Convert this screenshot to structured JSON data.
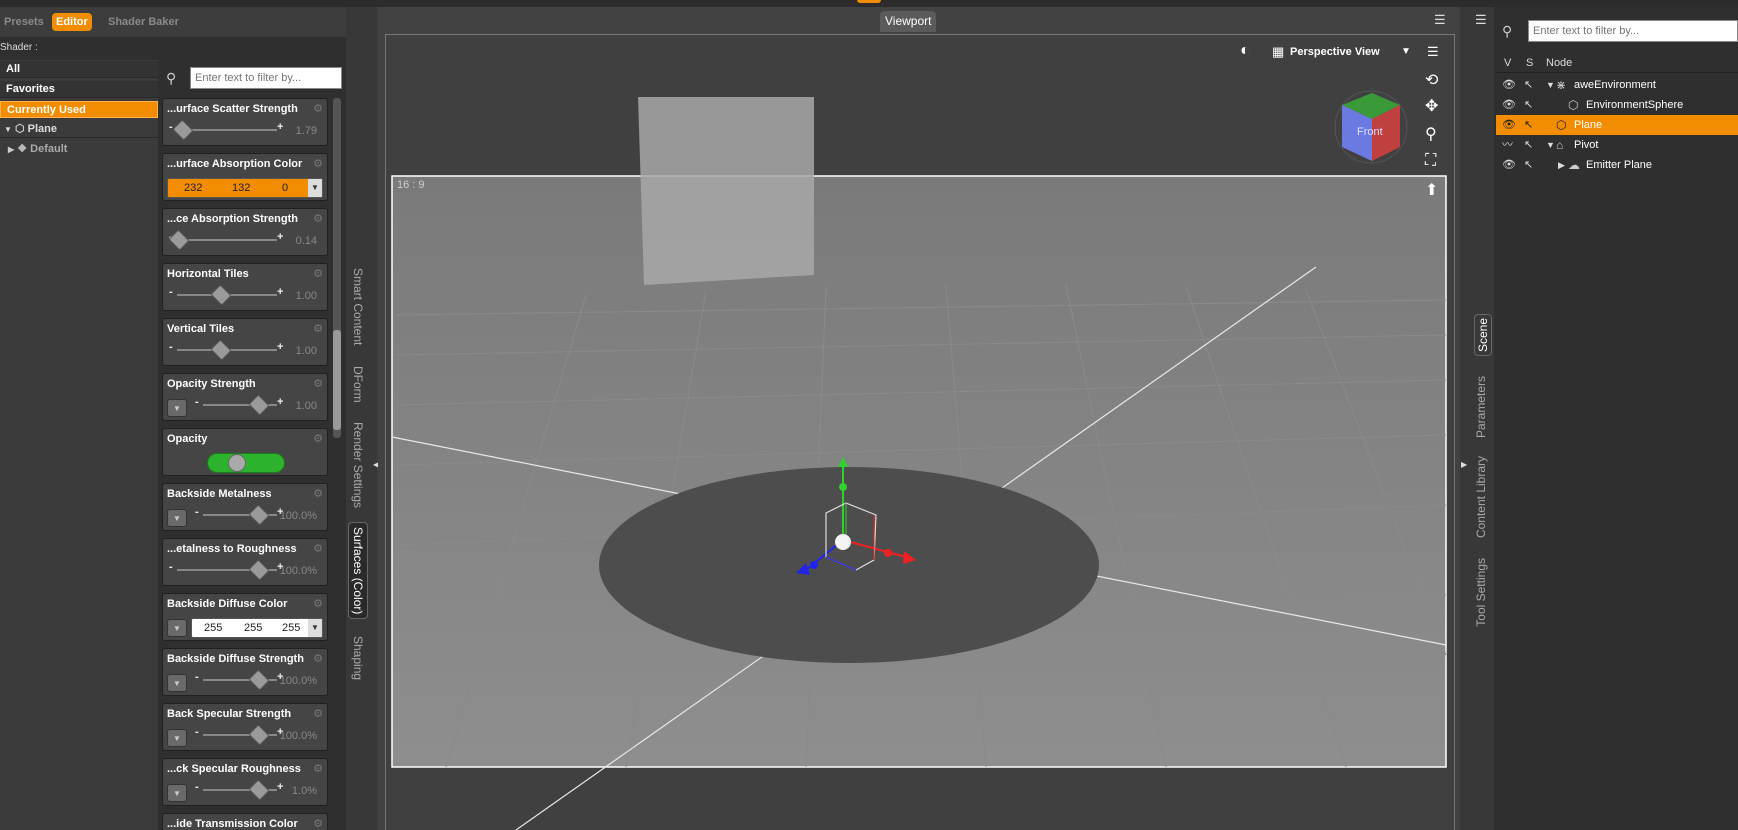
{
  "left": {
    "tabs": [
      "Presets",
      "Editor",
      "Shader Baker"
    ],
    "shader_label": "Shader :",
    "filter_placeholder": "Enter text to filter by...",
    "tree": {
      "all": "All",
      "favorites": "Favorites",
      "currently_used": "Currently Used",
      "plane": "Plane",
      "default": "Default"
    },
    "props": [
      {
        "title": "...urface Scatter Strength",
        "value": "1.79",
        "kind": "slider"
      },
      {
        "title": "...urface Absorption Color",
        "kind": "color",
        "r": "232",
        "g": "132",
        "b": "0",
        "bg": "#f28c00"
      },
      {
        "title": "...ce Absorption Strength",
        "value": "0.14",
        "kind": "slider"
      },
      {
        "title": "Horizontal Tiles",
        "value": "1.00",
        "kind": "slider"
      },
      {
        "title": "Vertical Tiles",
        "value": "1.00",
        "kind": "slider"
      },
      {
        "title": "Opacity Strength",
        "value": "1.00",
        "kind": "slider-drop"
      },
      {
        "title": "Opacity",
        "kind": "toggle",
        "toggle_label": "On"
      },
      {
        "title": "Backside Metalness",
        "value": "100.0%",
        "kind": "slider-drop"
      },
      {
        "title": "...etalness to Roughness",
        "value": "100.0%",
        "kind": "slider"
      },
      {
        "title": "Backside Diffuse Color",
        "kind": "color",
        "r": "255",
        "g": "255",
        "b": "255",
        "bg": "#ffffff"
      },
      {
        "title": "Backside Diffuse Strength",
        "value": "100.0%",
        "kind": "slider-drop"
      },
      {
        "title": "Back Specular Strength",
        "value": "100.0%",
        "kind": "slider-drop"
      },
      {
        "title": "...ck Specular Roughness",
        "value": "1.0%",
        "kind": "slider-drop"
      },
      {
        "title": "...ide Transmission Color",
        "kind": "title-only"
      }
    ],
    "vertical_tabs": [
      "Smart Content",
      "DForm",
      "Render Settings",
      "Surfaces (Color)",
      "Shaping"
    ]
  },
  "viewport": {
    "tab": "Viewport",
    "view_label": "Perspective View",
    "aspect": "16 : 9",
    "cube_label": "Front"
  },
  "right": {
    "vertical_tabs": [
      "Scene",
      "Parameters",
      "Content Library",
      "Tool Settings"
    ],
    "filter_placeholder": "Enter text to filter by...",
    "headers": [
      "V",
      "S",
      "Node"
    ],
    "nodes": [
      {
        "label": "aweEnvironment"
      },
      {
        "label": "EnvironmentSphere"
      },
      {
        "label": "Plane"
      },
      {
        "label": "Pivot"
      },
      {
        "label": "Emitter Plane"
      }
    ]
  },
  "colors": {
    "accent": "#f28c00",
    "toggle_on": "#2db22d"
  }
}
